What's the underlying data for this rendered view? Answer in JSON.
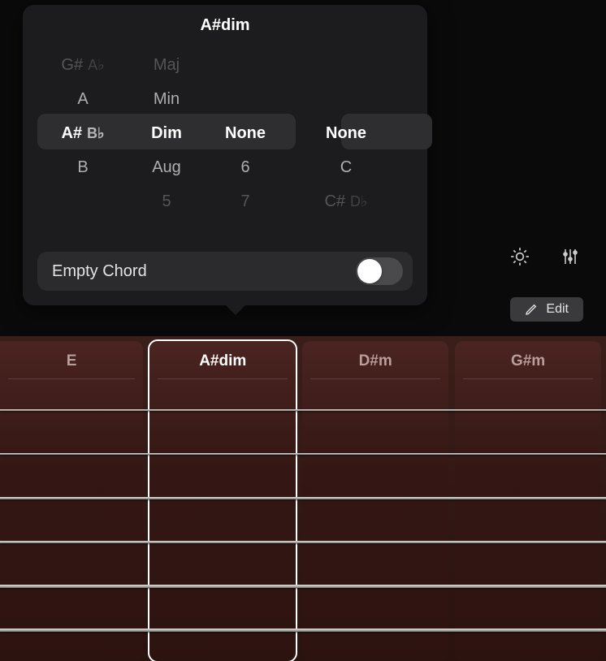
{
  "popover": {
    "title": "A#dim",
    "root": {
      "items": [
        {
          "main": "G#",
          "alt": "A♭",
          "state": "far"
        },
        {
          "main": "A",
          "alt": "",
          "state": "near"
        },
        {
          "main": "A#",
          "alt": "B♭",
          "state": "selected"
        },
        {
          "main": "B",
          "alt": "",
          "state": "near"
        },
        {
          "main": "",
          "alt": "",
          "state": "far"
        }
      ]
    },
    "quality": {
      "items": [
        {
          "main": "Maj",
          "state": "far"
        },
        {
          "main": "Min",
          "state": "near"
        },
        {
          "main": "Dim",
          "state": "selected"
        },
        {
          "main": "Aug",
          "state": "near"
        },
        {
          "main": "5",
          "state": "far"
        }
      ]
    },
    "extension": {
      "items": [
        {
          "main": "",
          "state": "far"
        },
        {
          "main": "",
          "state": "near"
        },
        {
          "main": "None",
          "state": "selected"
        },
        {
          "main": "6",
          "state": "near"
        },
        {
          "main": "7",
          "state": "far"
        }
      ]
    },
    "bass": {
      "items": [
        {
          "main": "",
          "alt": "",
          "state": "far"
        },
        {
          "main": "",
          "alt": "",
          "state": "near"
        },
        {
          "main": "None",
          "alt": "",
          "state": "selected"
        },
        {
          "main": "C",
          "alt": "",
          "state": "near"
        },
        {
          "main": "C#",
          "alt": "D♭",
          "state": "far"
        }
      ]
    },
    "empty_label": "Empty Chord",
    "empty_on": false
  },
  "toolbar": {
    "edit_label": "Edit"
  },
  "chords": [
    {
      "label": "E",
      "selected": false
    },
    {
      "label": "A#dim",
      "selected": true
    },
    {
      "label": "D#m",
      "selected": false
    },
    {
      "label": "G#m",
      "selected": false
    }
  ]
}
